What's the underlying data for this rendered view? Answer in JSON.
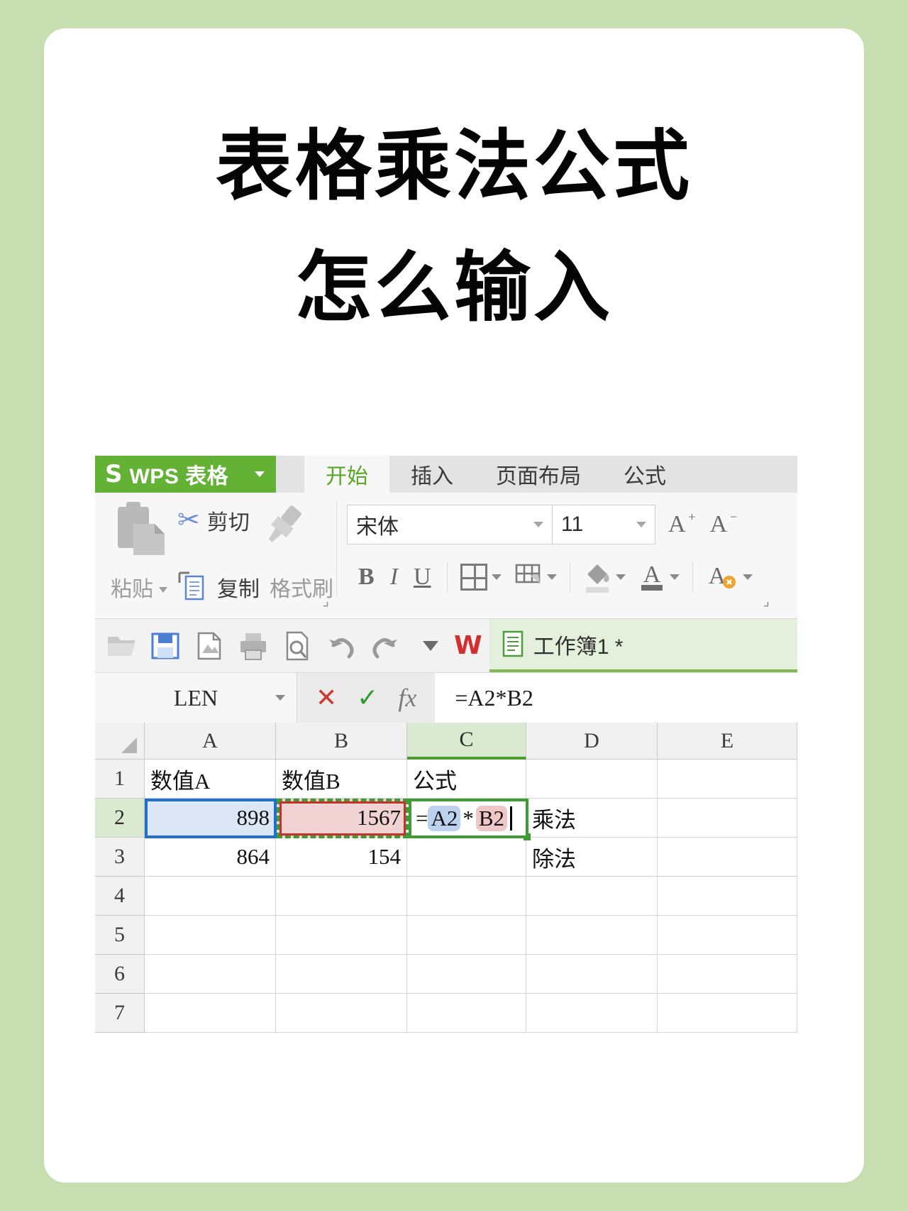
{
  "poster": {
    "title_line1": "表格乘法公式",
    "title_line2": "怎么输入",
    "background_color": "#c7dfb0",
    "card_color": "#ffffff"
  },
  "app": {
    "brand": {
      "mark": "S",
      "name": "WPS 表格",
      "accent_color": "#63b235"
    },
    "tabs": [
      {
        "label": "开始",
        "active": true
      },
      {
        "label": "插入",
        "active": false
      },
      {
        "label": "页面布局",
        "active": false
      },
      {
        "label": "公式",
        "active": false
      }
    ],
    "ribbon": {
      "clipboard": {
        "paste_label": "粘贴",
        "cut_label": "剪切",
        "copy_label": "复制",
        "format_painter_label": "格式刷"
      },
      "font": {
        "font_name": "宋体",
        "font_size": "11",
        "grow_font": "A",
        "shrink_font": "A",
        "bold": "B",
        "italic": "I",
        "underline": "U"
      }
    },
    "quick_access": {
      "icons": [
        "open-icon",
        "save-icon",
        "pdf-icon",
        "print-icon",
        "print-preview-icon",
        "undo-icon",
        "redo-icon"
      ],
      "workbook_tab": "工作簿1 *",
      "w_logo": "W"
    },
    "formula_bar": {
      "name_box": "LEN",
      "cancel": "✕",
      "confirm": "✓",
      "fx": "fx",
      "formula": "=A2*B2"
    }
  },
  "chart_data": {
    "type": "table",
    "title": "工作簿1",
    "columns": [
      "A",
      "B",
      "C",
      "D",
      "E"
    ],
    "row_numbers": [
      "1",
      "2",
      "3",
      "4",
      "5",
      "6",
      "7"
    ],
    "selected_column": "C",
    "selected_row": "2",
    "active_cell": "C2",
    "editing_formula": "=A2*B2",
    "rows": [
      {
        "n": "1",
        "A": "数值A",
        "B": "数值B",
        "C": "公式",
        "D": "",
        "E": ""
      },
      {
        "n": "2",
        "A": "898",
        "B": "1567",
        "C": "=A2*B2",
        "D": "乘法",
        "E": ""
      },
      {
        "n": "3",
        "A": "864",
        "B": "154",
        "C": "",
        "D": "除法",
        "E": ""
      },
      {
        "n": "4",
        "A": "",
        "B": "",
        "C": "",
        "D": "",
        "E": ""
      },
      {
        "n": "5",
        "A": "",
        "B": "",
        "C": "",
        "D": "",
        "E": ""
      },
      {
        "n": "6",
        "A": "",
        "B": "",
        "C": "",
        "D": "",
        "E": ""
      },
      {
        "n": "7",
        "A": "",
        "B": "",
        "C": "",
        "D": "",
        "E": ""
      }
    ],
    "formula_parts": {
      "eq": "=",
      "ref_a": "A2",
      "op": "*",
      "ref_b": "B2"
    },
    "highlight_colors": {
      "ref_a": "#bdd2ef",
      "ref_b": "#f0c7c7",
      "active_border": "#3f9c35"
    }
  }
}
